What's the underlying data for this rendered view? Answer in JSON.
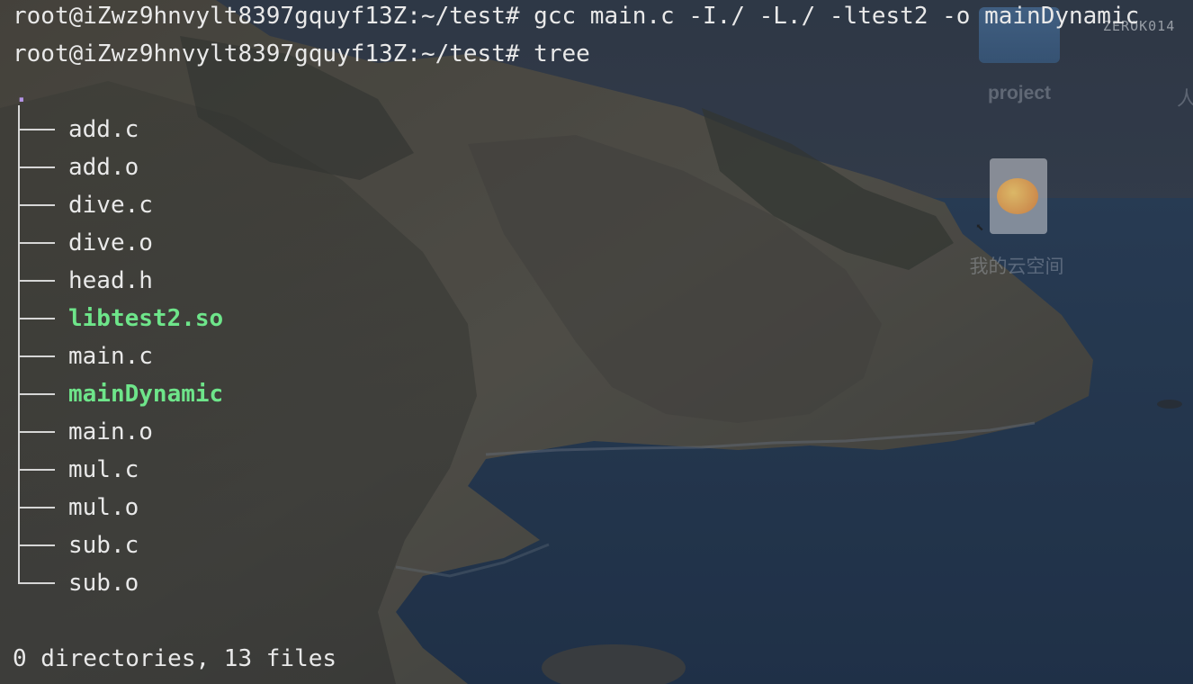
{
  "desktop": {
    "watermark": "ZEROK014",
    "folder_label": "project",
    "cloud_drive_label": "我的云空间",
    "edge_glyph": "人"
  },
  "terminal": {
    "lines": [
      "root@iZwz9hnvylt8397gquyf13Z:~/test# gcc main.c -I./ -L./ -ltest2 -o mainDynamic",
      "root@iZwz9hnvylt8397gquyf13Z:~/test# tree"
    ],
    "tree_root": ".",
    "files": [
      {
        "name": "add.c",
        "type": "file"
      },
      {
        "name": "add.o",
        "type": "file"
      },
      {
        "name": "dive.c",
        "type": "file"
      },
      {
        "name": "dive.o",
        "type": "file"
      },
      {
        "name": "head.h",
        "type": "file"
      },
      {
        "name": "libtest2.so",
        "type": "executable"
      },
      {
        "name": "main.c",
        "type": "file"
      },
      {
        "name": "mainDynamic",
        "type": "executable"
      },
      {
        "name": "main.o",
        "type": "file"
      },
      {
        "name": "mul.c",
        "type": "file"
      },
      {
        "name": "mul.o",
        "type": "file"
      },
      {
        "name": "sub.c",
        "type": "file"
      },
      {
        "name": "sub.o",
        "type": "file"
      }
    ],
    "summary": "0 directories, 13 files"
  },
  "colors": {
    "text": "#e9e9e9",
    "executable": "#6ee58a",
    "root_dot": "#b494e6"
  }
}
